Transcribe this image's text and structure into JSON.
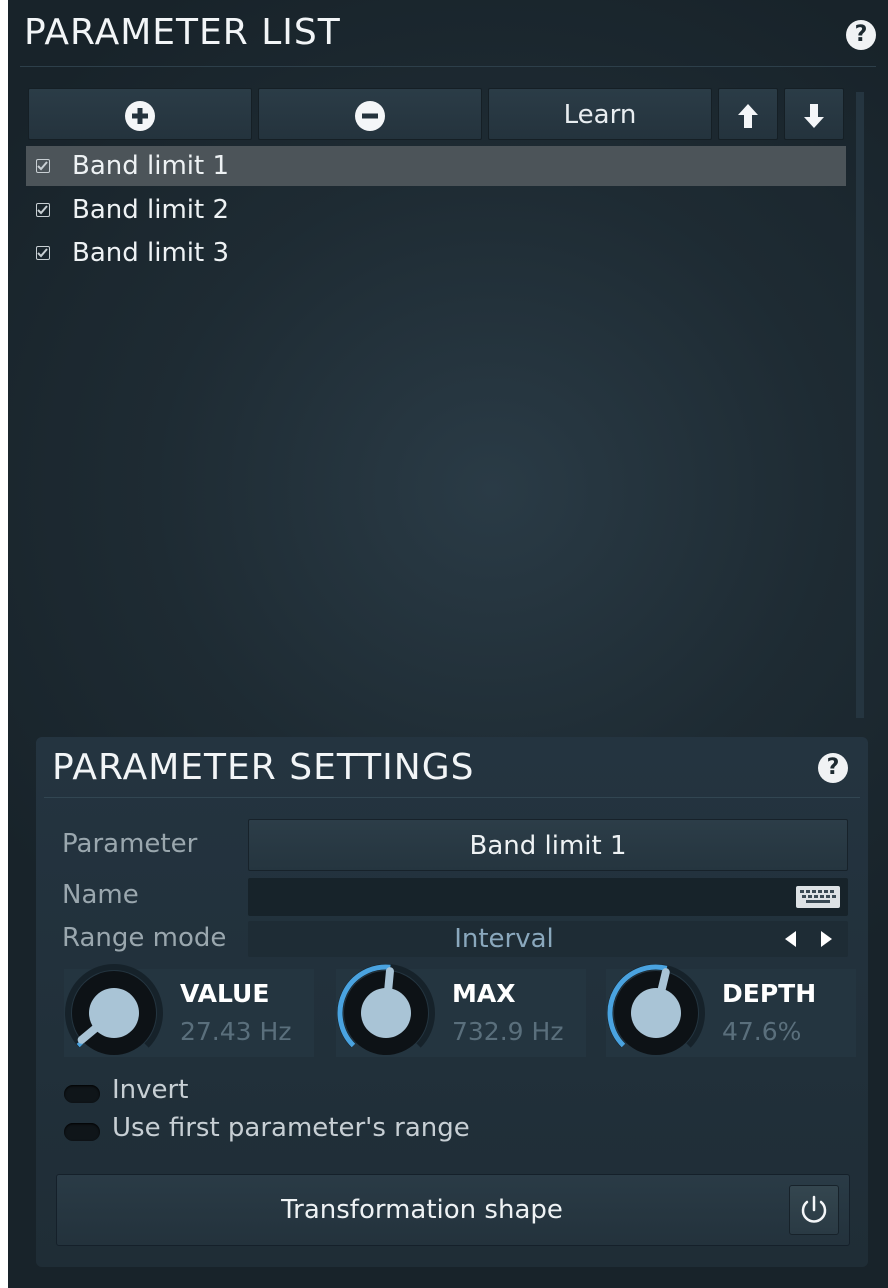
{
  "parameter_list": {
    "title": "PARAMETER LIST",
    "help_symbol": "?",
    "toolbar": {
      "add_icon": "plus-circle-icon",
      "remove_icon": "minus-circle-icon",
      "learn_label": "Learn",
      "up_icon": "arrow-up-icon",
      "down_icon": "arrow-down-icon"
    },
    "items": [
      {
        "label": "Band limit 1",
        "checked": true,
        "selected": true
      },
      {
        "label": "Band limit 2",
        "checked": true,
        "selected": false
      },
      {
        "label": "Band limit 3",
        "checked": true,
        "selected": false
      }
    ]
  },
  "parameter_settings": {
    "title": "PARAMETER SETTINGS",
    "help_symbol": "?",
    "parameter_label": "Parameter",
    "parameter_value": "Band limit 1",
    "name_label": "Name",
    "name_value": "",
    "range_mode_label": "Range mode",
    "range_mode_value": "Interval",
    "knobs": [
      {
        "title": "VALUE",
        "value": "27.43 Hz",
        "fraction": 0.02
      },
      {
        "title": "MAX",
        "value": "732.9 Hz",
        "fraction": 0.52
      },
      {
        "title": "DEPTH",
        "value": "47.6%",
        "fraction": 0.55
      }
    ],
    "invert_label": "Invert",
    "invert_on": false,
    "use_first_range_label": "Use first parameter's range",
    "use_first_range_on": false,
    "transformation_shape_label": "Transformation shape",
    "power_icon": "power-icon"
  },
  "colors": {
    "accent": "#4aa3e0",
    "knob_fill": "#a9c4d6",
    "range_value": "#8aa8bd"
  }
}
